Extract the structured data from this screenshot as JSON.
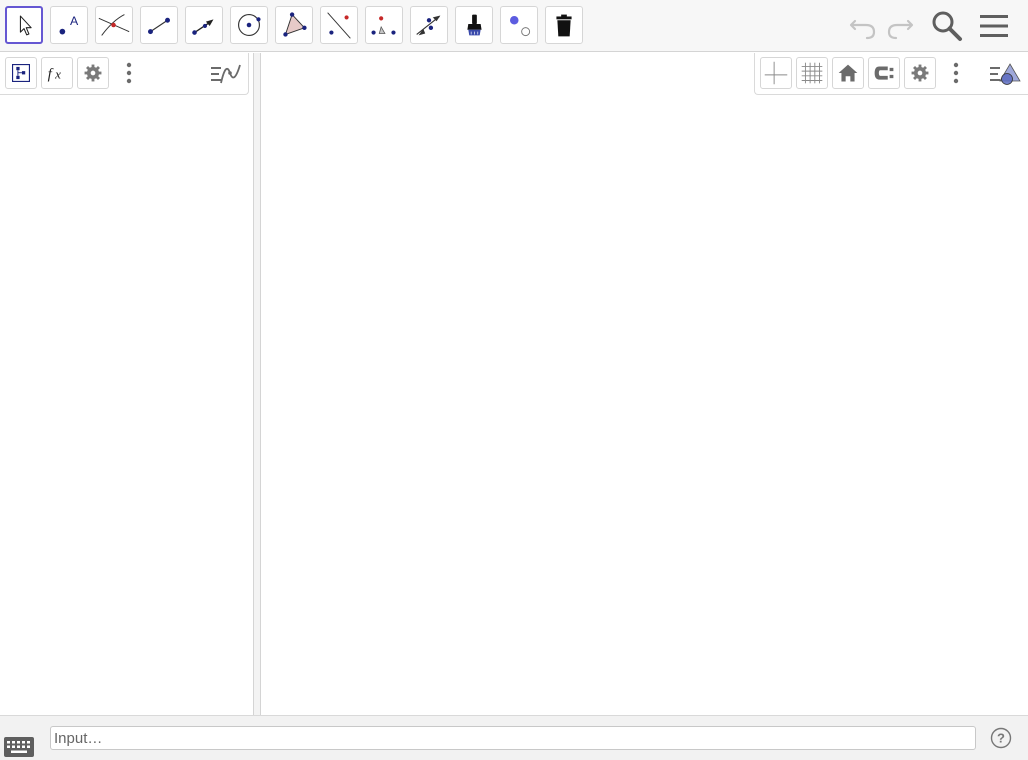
{
  "toolbar": {
    "tools": [
      {
        "name": "move-tool",
        "icon": "cursor-arrow-icon",
        "active": true
      },
      {
        "name": "point-tool",
        "icon": "point-label-icon",
        "label_glyph": "A"
      },
      {
        "name": "intersect-tool",
        "icon": "intersect-icon"
      },
      {
        "name": "segment-tool",
        "icon": "segment-icon"
      },
      {
        "name": "vector-tool",
        "icon": "vector-icon"
      },
      {
        "name": "circle-tool",
        "icon": "circle-center-point-icon"
      },
      {
        "name": "polygon-tool",
        "icon": "polygon-icon"
      },
      {
        "name": "perpendicular-line-tool",
        "icon": "perpendicular-line-icon"
      },
      {
        "name": "angle-tool",
        "icon": "angle-icon"
      },
      {
        "name": "reflect-tool",
        "icon": "reflect-icon"
      },
      {
        "name": "pen-tool",
        "icon": "brush-icon"
      },
      {
        "name": "show-hide-object-tool",
        "icon": "show-hide-icon"
      },
      {
        "name": "delete-tool",
        "icon": "trash-icon"
      }
    ],
    "right_buttons": [
      "undo-icon",
      "redo-icon",
      "search-icon",
      "menu-icon"
    ]
  },
  "algebra_style_bar": [
    "algebra-description-icon",
    "fx-icon",
    "gear-icon",
    "more-vertical-icon",
    "algebra-view-toggle-icon"
  ],
  "graphics_style_bar": [
    "axes-icon",
    "grid-icon",
    "home-icon",
    "point-capturing-icon",
    "gear-icon",
    "more-vertical-icon",
    "graphics-view-toggle-icon"
  ],
  "colors": {
    "accent": "#6557d2",
    "point_blue": "#1565c0",
    "point_dark": "#1a237e",
    "icon_gray": "#6b6b6b"
  },
  "input": {
    "placeholder": "Input…",
    "value": ""
  }
}
